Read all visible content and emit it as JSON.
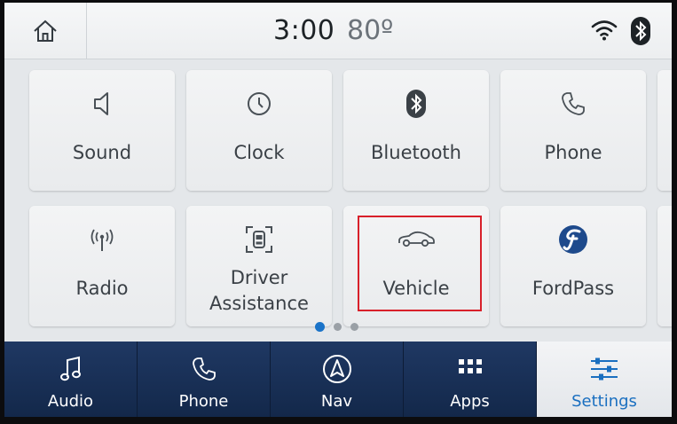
{
  "status": {
    "time": "3:00",
    "temperature": "80º",
    "icons": [
      "home-icon",
      "wifi-icon",
      "bluetooth-icon"
    ]
  },
  "tiles": [
    {
      "label": "Sound",
      "icon": "speaker-icon"
    },
    {
      "label": "Clock",
      "icon": "clock-icon"
    },
    {
      "label": "Bluetooth",
      "icon": "bluetooth-icon"
    },
    {
      "label": "Phone",
      "icon": "phone-icon"
    },
    {
      "label": "Radio",
      "icon": "antenna-icon"
    },
    {
      "label_line1": "Driver",
      "label_line2": "Assistance",
      "icon": "driver-assist-icon"
    },
    {
      "label": "Vehicle",
      "icon": "car-icon"
    },
    {
      "label": "FordPass",
      "icon": "fordpass-logo-icon"
    }
  ],
  "pager": {
    "pages": 3,
    "current": 1
  },
  "nav": [
    {
      "label": "Audio",
      "icon": "music-note-icon"
    },
    {
      "label": "Phone",
      "icon": "phone-icon"
    },
    {
      "label": "Nav",
      "icon": "compass-icon"
    },
    {
      "label": "Apps",
      "icon": "grid-icon"
    },
    {
      "label": "Settings",
      "icon": "sliders-icon",
      "active": true
    }
  ],
  "colors": {
    "nav_background": "#1f3863",
    "accent": "#1a73c8",
    "highlight_box": "#d8202a"
  }
}
